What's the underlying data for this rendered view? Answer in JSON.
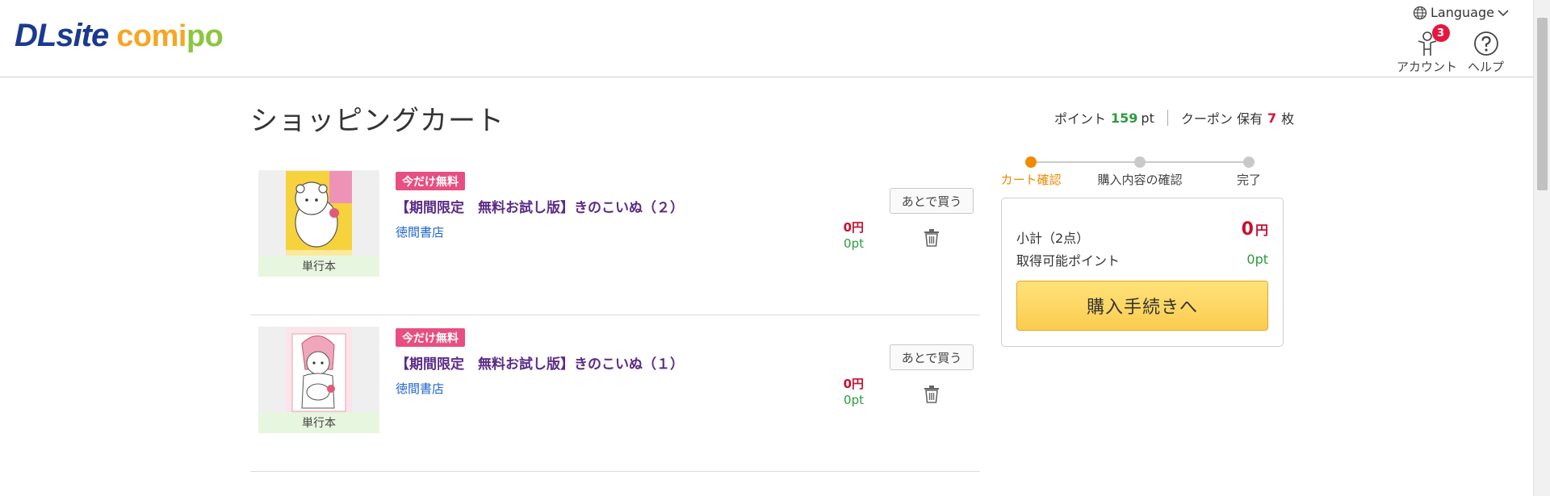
{
  "header": {
    "logo_dl": "DLsite",
    "logo_comipo_a": "comi",
    "logo_comipo_b": "po",
    "language_label": "Language",
    "account_label": "アカウント",
    "account_badge": "3",
    "help_label": "ヘルプ"
  },
  "page": {
    "title": "ショッピングカート"
  },
  "points_bar": {
    "points_label": "ポイント",
    "points_value": "159",
    "points_unit": "pt",
    "coupon_label": "クーポン 保有",
    "coupon_value": "7",
    "coupon_unit": "枚"
  },
  "cart": {
    "items": [
      {
        "tag": "今だけ無料",
        "title": "【期間限定　無料お試し版】きのこいぬ（２）",
        "publisher": "徳間書店",
        "format": "単行本",
        "price": "0円",
        "points": "0pt",
        "later_label": "あとで買う",
        "cover_bg": "#f6d23c"
      },
      {
        "tag": "今だけ無料",
        "title": "【期間限定　無料お試し版】きのこいぬ（１）",
        "publisher": "徳間書店",
        "format": "単行本",
        "price": "0円",
        "points": "0pt",
        "later_label": "あとで買う",
        "cover_bg": "#f9dbe1"
      }
    ]
  },
  "steps": [
    {
      "label": "カート確認",
      "active": true
    },
    {
      "label": "購入内容の確認",
      "active": false
    },
    {
      "label": "完了",
      "active": false
    }
  ],
  "summary": {
    "subtotal_label": "小計（2点）",
    "subtotal_value": "0",
    "subtotal_unit": "円",
    "points_label": "取得可能ポイント",
    "points_value": "0pt",
    "buy_label": "購入手続きへ"
  },
  "colors": {
    "accent_orange": "#f08a00",
    "price_red": "#c8102e",
    "points_green": "#2d9b3e",
    "tag_pink": "#e84f80",
    "title_purple": "#5b2c87"
  }
}
